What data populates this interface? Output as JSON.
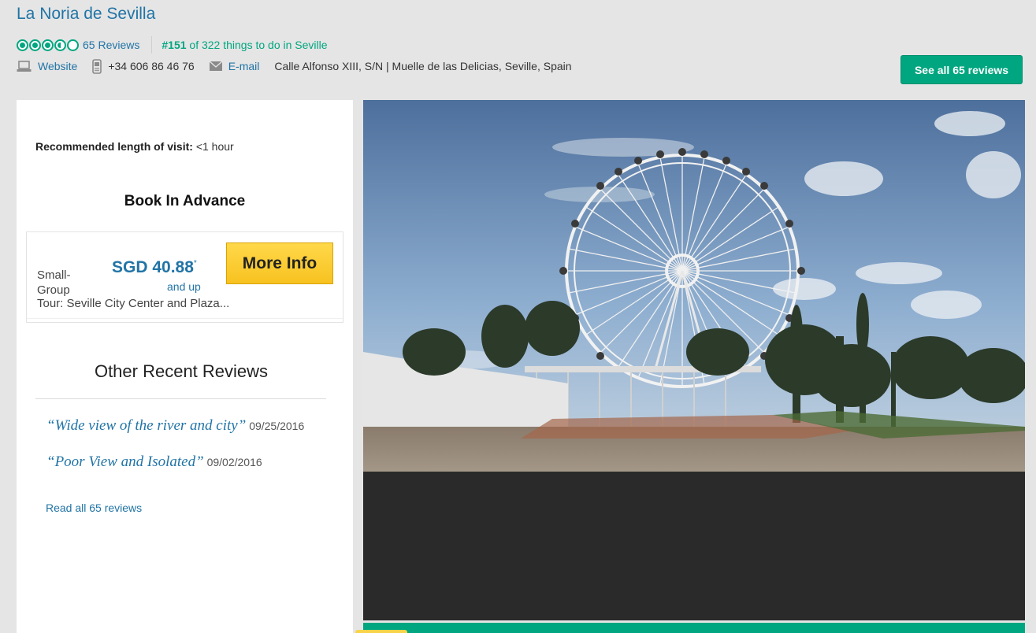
{
  "header": {
    "title": "La Noria de Sevilla",
    "rating": {
      "bubbles": [
        1,
        1,
        1,
        0.5,
        0
      ],
      "reviews_label": "65 Reviews"
    },
    "rank": {
      "number": "#151",
      "text": " of 322 things to do in Seville"
    },
    "contact": {
      "website_label": "Website",
      "phone": "+34 606 86 46 76",
      "email_label": "E-mail",
      "address": "Calle Alfonso XIII, S/N | Muelle de las Delicias, Seville, Spain"
    },
    "see_all_label": "See all 65 reviews"
  },
  "sidebar": {
    "recommended_label": "Recommended length of visit:",
    "recommended_value": "<1 hour",
    "book_title": "Book In Advance",
    "tour": {
      "name_line1": "Small-",
      "name_line2": "Group",
      "name_rest": "Tour: Seville City Center and Plaza...",
      "price": "SGD 40.88",
      "price_mark": "*",
      "and_up": "and up",
      "more_info_label": "More Info"
    },
    "other_reviews_title": "Other Recent Reviews",
    "reviews": [
      {
        "quote": "“Wide view of the river and city”",
        "date": "09/25/2016"
      },
      {
        "quote": "“Poor View and Isolated”",
        "date": "09/02/2016"
      }
    ],
    "read_all_label": "Read all 65 reviews"
  },
  "colors": {
    "accent_green": "#00a680",
    "link_blue": "#2174a6",
    "button_yellow": "#f7c220"
  },
  "icons": [
    "laptop-icon",
    "phone-icon",
    "envelope-icon",
    "rating-bubble-icon"
  ]
}
